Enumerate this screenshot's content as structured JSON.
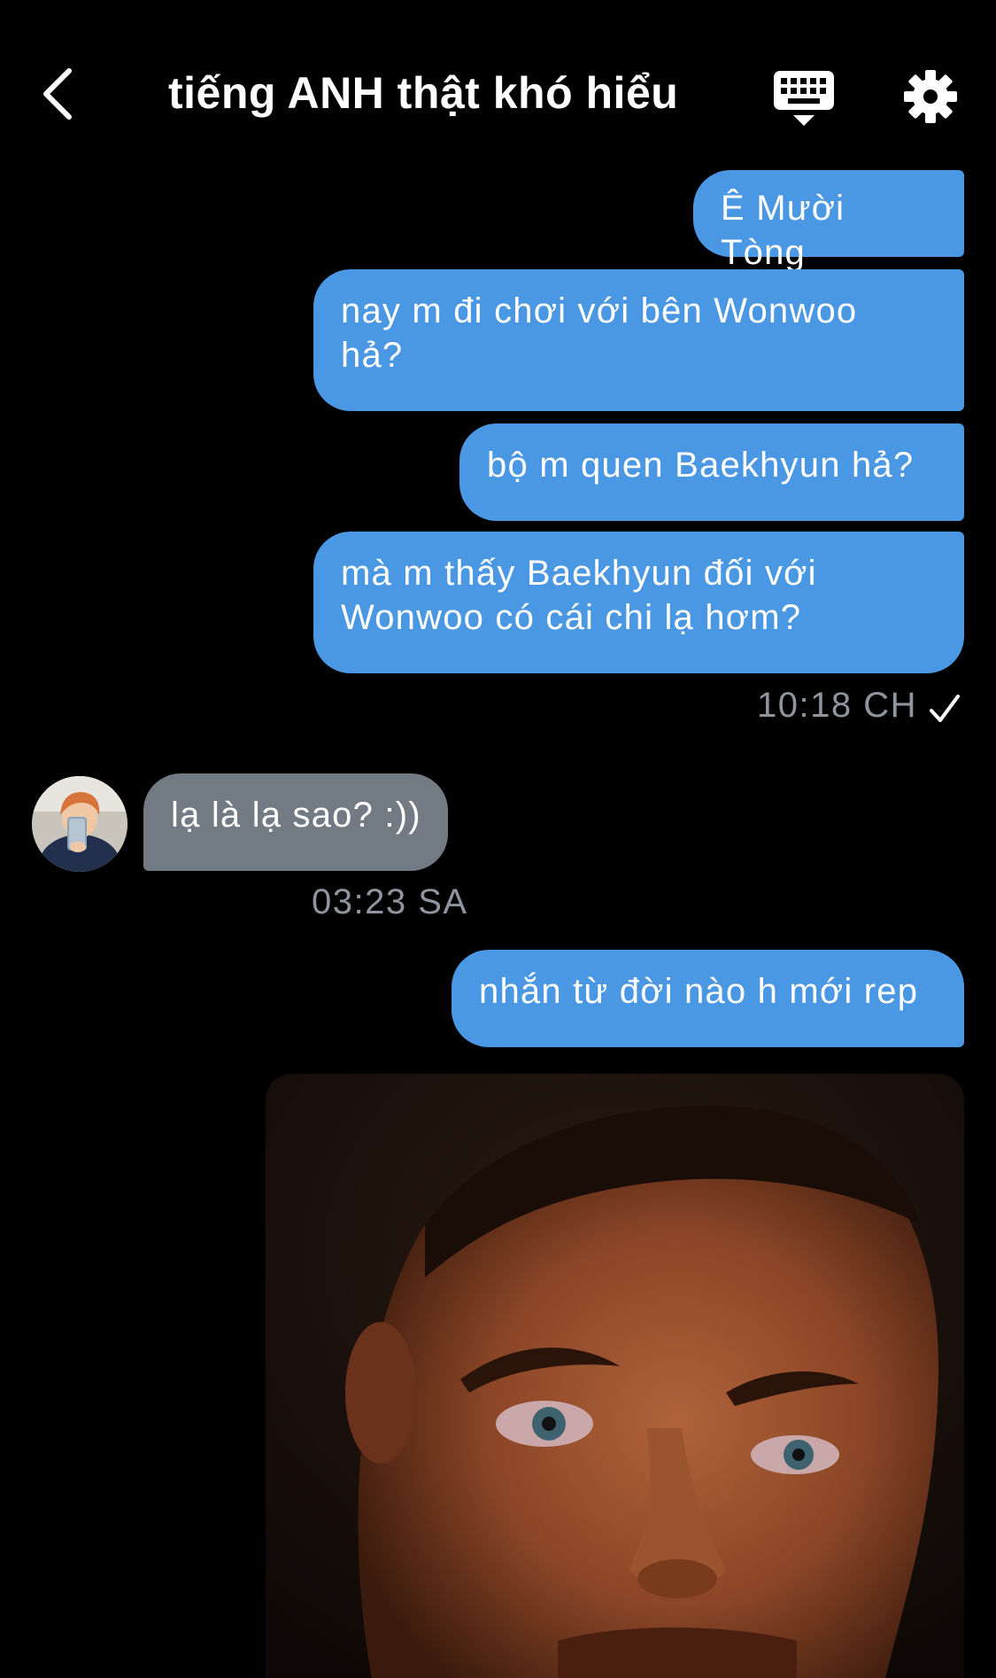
{
  "header": {
    "back_icon": "chevron-left-icon",
    "title": "tiếng ANH thật khó hiểu",
    "keyboard_icon": "keyboard-icon",
    "settings_icon": "gear-icon"
  },
  "colors": {
    "outgoing_bubble": "#4a97e4",
    "incoming_bubble": "#727a84",
    "background": "#000000",
    "timestamp": "#8e959e"
  },
  "messages": [
    {
      "direction": "out",
      "text": "Ê Mười Tòng"
    },
    {
      "direction": "out",
      "text": "nay m đi chơi với bên Wonwoo\nhả?"
    },
    {
      "direction": "out",
      "text": "bộ m quen Baekhyun hả?"
    },
    {
      "direction": "out",
      "text": "mà m thấy Baekhyun đối với\nWonwoo có cái chi lạ hơm?"
    },
    {
      "direction": "in",
      "text": "lạ là lạ sao? :))"
    },
    {
      "direction": "out",
      "text": "nhắn từ đời nào h mới rep"
    },
    {
      "direction": "out",
      "type": "image",
      "description": "meme-face-photo"
    }
  ],
  "timestamps": {
    "group1": "10:18 CH",
    "group2": "03:23 SA"
  },
  "status_icon": "checkmark-icon"
}
